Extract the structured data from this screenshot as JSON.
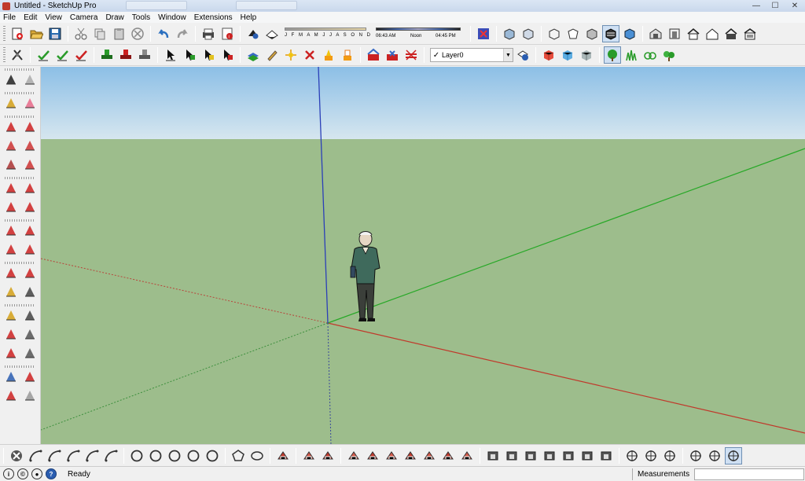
{
  "window": {
    "title": "Untitled - SketchUp Pro",
    "minimize": "—",
    "maximize": "☐",
    "close": "✕"
  },
  "menu": [
    "File",
    "Edit",
    "View",
    "Camera",
    "Draw",
    "Tools",
    "Window",
    "Extensions",
    "Help"
  ],
  "shadow_settings": {
    "months": "J F M A M J J A S O N D",
    "time_start": "06:43 AM",
    "time_noon": "Noon",
    "time_end": "04:45 PM"
  },
  "layers": {
    "current": "Layer0",
    "check": "✓"
  },
  "status": {
    "text": "Ready",
    "measurements_label": "Measurements",
    "measurements_value": "",
    "help_glyph": "?",
    "info_glyph": "i",
    "user_glyph": "©"
  },
  "scene": {
    "sky_top": "#8cbfe6",
    "sky_bottom": "#d8e8f0",
    "ground": "#9dbd8c",
    "red_axis": "#c0392b",
    "green_axis": "#27a827",
    "blue_axis": "#2b3fb8"
  },
  "icons": {
    "toolbar1": [
      "new-model-icon",
      "open-icon",
      "save-icon",
      "cut-icon",
      "copy-icon",
      "paste-icon",
      "erase-icon",
      "undo-icon",
      "redo-icon",
      "print-icon",
      "model-info-icon",
      "shadows-toggle-icon",
      "fog-icon",
      "display-section-planes-icon",
      "iso-view-icon",
      "top-view-icon",
      "front-view-icon",
      "right-view-icon",
      "back-view-icon",
      "left-view-icon",
      "xray-icon",
      "back-edges-icon",
      "wireframe-icon",
      "hidden-line-icon",
      "shaded-icon",
      "shaded-textures-icon",
      "warehouse-get-models-icon",
      "share-model-icon",
      "share-component-icon",
      "extension-warehouse-icon",
      "house-icon",
      "house-outline-icon",
      "house-filled-icon"
    ],
    "toolbar2": [
      "sandbox-icon",
      "validate-icon",
      "check-a-icon",
      "check-b-icon",
      "stamp-green-icon",
      "stamp-red-icon",
      "stamp-gray-icon",
      "select-arrow-icon",
      "arrow-green-icon",
      "arrow-yellow-icon",
      "arrow-dark-icon",
      "layer-stack-icon",
      "pencil-layer-icon",
      "sparkle-icon",
      "close-red-icon",
      "flag-icon",
      "flag-b-icon",
      "section-red-icon",
      "section-red-b-icon",
      "section-cross-icon",
      "layer-manager-icon",
      "cube-red-icon",
      "cube-blue-icon",
      "cube-gray-icon",
      "tree-icon",
      "grass-icon",
      "bush-icon",
      "plant-icon"
    ],
    "left": [
      "select-icon",
      "make-component-icon",
      "paint-bucket-icon",
      "eraser-icon",
      "line-icon",
      "freehand-icon",
      "rectangle-icon",
      "rotated-rectangle-icon",
      "circle-icon",
      "polygon-icon",
      "arc-icon",
      "two-point-arc-icon",
      "three-point-arc-icon",
      "pie-icon",
      "move-icon",
      "push-pull-icon",
      "rotate-icon",
      "follow-me-icon",
      "scale-icon",
      "offset-icon",
      "tape-measure-icon",
      "dimension-icon",
      "protractor-icon",
      "text-icon",
      "axes-icon",
      "3d-text-icon",
      "orbit-icon",
      "pan-icon",
      "zoom-icon",
      "zoom-window-icon",
      "zoom-extents-icon",
      "previous-view-icon",
      "position-camera-icon",
      "look-around-icon",
      "walk-icon",
      "section-plane-icon"
    ],
    "bottom": [
      "sandbox-tools-icon",
      "arc-bottom-icon",
      "arc-b-icon",
      "arc-c-icon",
      "arc-d-icon",
      "arc-e-icon",
      "arc-f-icon",
      "circle-a-icon",
      "circle-b-icon",
      "circle-c-icon",
      "circle-d-icon",
      "polygon-pent-icon",
      "ellipse-icon",
      "push-face-icon",
      "hand-icon",
      "solid-a-icon",
      "solid-b-icon",
      "sand-a-icon",
      "sand-b-icon",
      "sand-c-icon",
      "sand-d-icon",
      "sand-e-icon",
      "sand-f-icon",
      "solid-c-icon",
      "solid-d-icon",
      "solid-e-icon",
      "solid-f-icon",
      "solid-g-icon",
      "solid-h-icon",
      "solid-i-icon",
      "walk-b-icon",
      "pan-b-icon",
      "axis-b-icon",
      "target-icon",
      "cube-view-icon",
      "cube-view-b-icon"
    ]
  }
}
